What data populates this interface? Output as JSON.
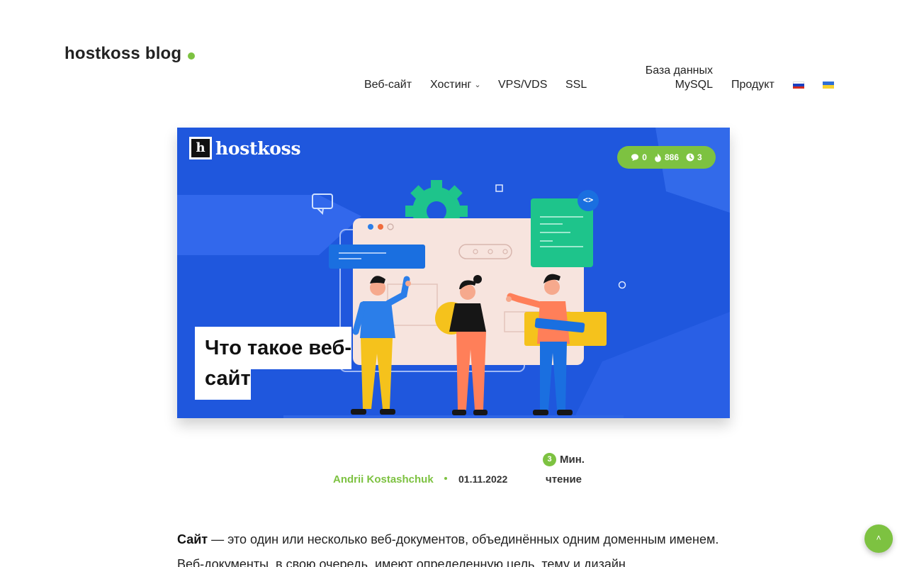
{
  "header": {
    "logo": "hostkoss blog",
    "nav": {
      "web": "Веб-сайт",
      "hosting": "Хостинг",
      "vps": "VPS/VDS",
      "ssl": "SSL",
      "db_line1": "База данных",
      "db_line2": "MySQL",
      "product": "Продукт"
    },
    "languages": [
      "ru",
      "ua"
    ]
  },
  "hero": {
    "brand": "hostkoss",
    "brand_letter": "h",
    "code_tag": "<>",
    "stats": {
      "comments": "0",
      "views": "886",
      "read_minutes": "3"
    },
    "title": "Что такое веб-сайт"
  },
  "meta": {
    "author": "Andrii Kostashchuk",
    "date": "01.11.2022",
    "read_badge": "3",
    "read_line1": "Мин.",
    "read_line2": "чтение"
  },
  "article": {
    "lead_bold": "Сайт",
    "lead_text": " — это один или несколько веб-документов, объединённых одним доменным именем. Веб-документы, в свою очередь, имеют определенную цель, тему и дизайн."
  },
  "colors": {
    "accent": "#7dc241",
    "hero_bg": "#1f57dd"
  },
  "icons": {
    "to_top": "arrow-up-icon"
  }
}
